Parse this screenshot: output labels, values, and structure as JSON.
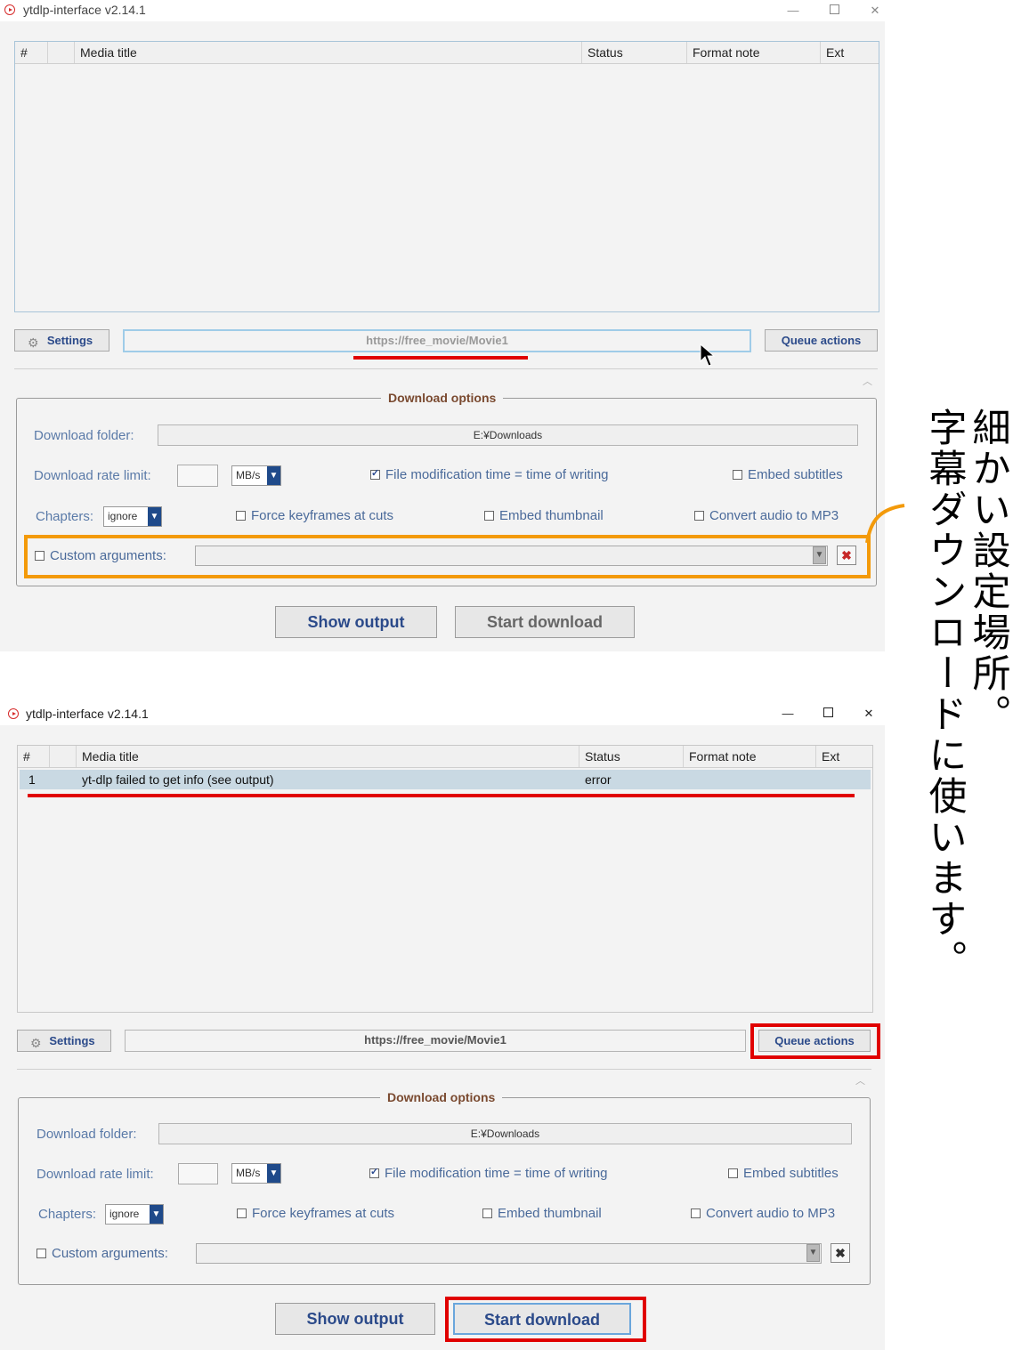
{
  "colors": {
    "accent_blue": "#2b4a8a",
    "highlight_red": "#e00000",
    "highlight_orange": "#f39a0a",
    "legend_brown": "#7a4a30"
  },
  "window1": {
    "title": "ytdlp-interface v2.14.1",
    "controls": [
      "—",
      "□",
      "✕"
    ],
    "columns": [
      "#",
      "",
      "Media title",
      "Status",
      "Format note",
      "Ext"
    ],
    "settings_label": "Settings",
    "url_value": "https://free_movie/Movie1",
    "queue_actions_label": "Queue actions",
    "download_options_legend": "Download options",
    "download_folder_label": "Download folder:",
    "download_folder_value": "E:¥Downloads",
    "rate_limit_label": "Download rate limit:",
    "rate_unit": "MB/s",
    "file_mod_time_label": "File modification time = time of writing",
    "file_mod_time_checked": true,
    "embed_subtitles_label": "Embed subtitles",
    "chapters_label": "Chapters:",
    "chapters_value": "ignore",
    "force_keyframes_label": "Force keyframes at cuts",
    "embed_thumbnail_label": "Embed thumbnail",
    "convert_audio_label": "Convert audio to MP3",
    "custom_args_label": "Custom arguments:",
    "show_output_label": "Show output",
    "start_download_label": "Start download"
  },
  "window2": {
    "title": "ytdlp-interface v2.14.1",
    "controls": [
      "—",
      "□",
      "✕"
    ],
    "columns": [
      "#",
      "",
      "Media title",
      "Status",
      "Format note",
      "Ext"
    ],
    "rows": [
      {
        "num": "1",
        "title": "yt-dlp failed to get info (see output)",
        "status": "error"
      }
    ],
    "settings_label": "Settings",
    "url_value": "https://free_movie/Movie1",
    "queue_actions_label": "Queue actions",
    "download_options_legend": "Download options",
    "download_folder_label": "Download folder:",
    "download_folder_value": "E:¥Downloads",
    "rate_limit_label": "Download rate limit:",
    "rate_unit": "MB/s",
    "file_mod_time_label": "File modification time = time of writing",
    "file_mod_time_checked": true,
    "embed_subtitles_label": "Embed subtitles",
    "chapters_label": "Chapters:",
    "chapters_value": "ignore",
    "force_keyframes_label": "Force keyframes at cuts",
    "embed_thumbnail_label": "Embed thumbnail",
    "convert_audio_label": "Convert audio to MP3",
    "custom_args_label": "Custom arguments:",
    "show_output_label": "Show output",
    "start_download_label": "Start download"
  },
  "annotation": {
    "line1": "細かい設定場所。",
    "line2": "字幕ダウンロードに使います。"
  }
}
